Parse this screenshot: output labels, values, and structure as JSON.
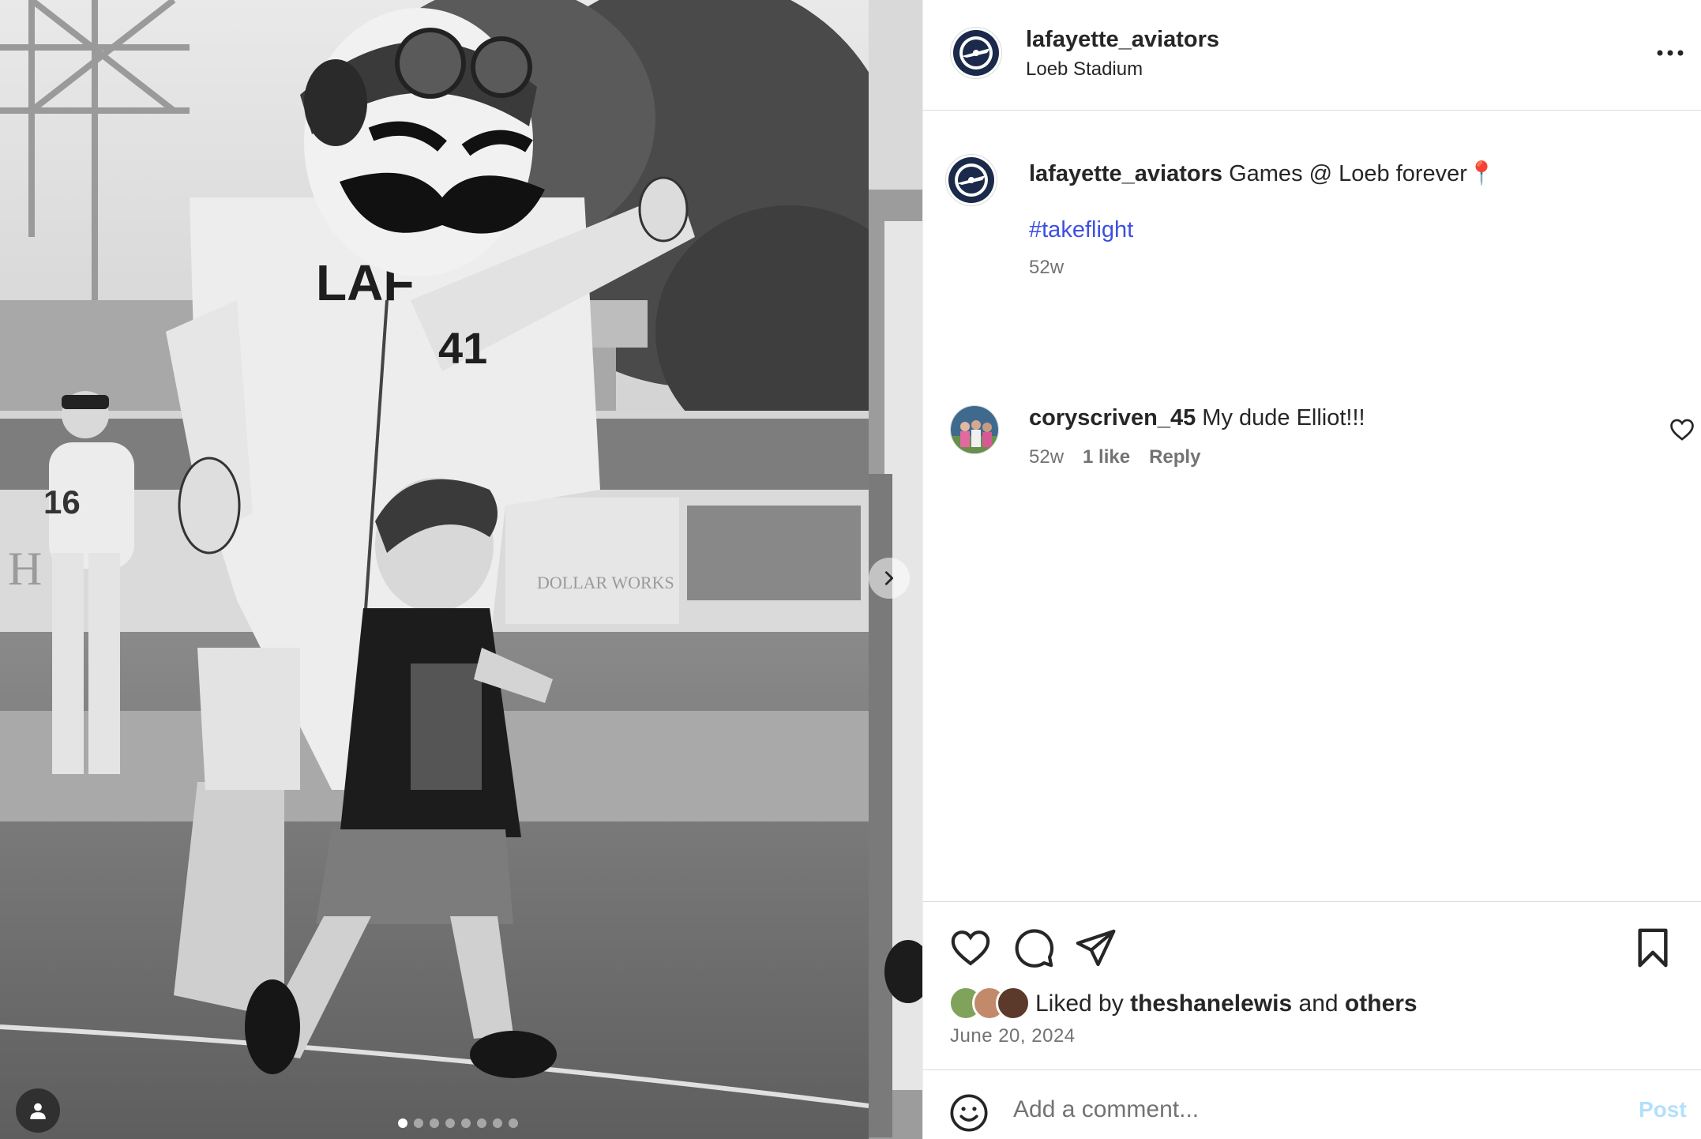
{
  "post": {
    "username": "lafayette_aviators",
    "location": "Loeb Stadium",
    "caption": "Games @ Loeb forever📍",
    "hashtag": "#takeflight",
    "caption_age": "52w"
  },
  "comments": [
    {
      "username": "coryscriven_45",
      "text": "My dude Elliot!!!",
      "age": "52w",
      "likes": "1 like",
      "reply_label": "Reply"
    }
  ],
  "likes": {
    "prefix": "Liked by",
    "user": "theshanelewis",
    "joiner": "and",
    "others": "others",
    "date": "June 20, 2024"
  },
  "comment_box": {
    "placeholder": "Add a comment...",
    "post_label": "Post"
  },
  "carousel": {
    "slide_count": 8,
    "active_index": 0
  },
  "icons": {
    "more": "more-options-icon",
    "like": "heart-icon",
    "comment": "comment-icon",
    "share": "share-icon",
    "save": "bookmark-icon",
    "emoji": "emoji-icon",
    "tag": "user-tag-icon",
    "next": "chevron-right-icon"
  },
  "colors": {
    "hashtag": "#3d4fe0",
    "post_button": "#b2dffc",
    "muted_text": "#737373"
  }
}
